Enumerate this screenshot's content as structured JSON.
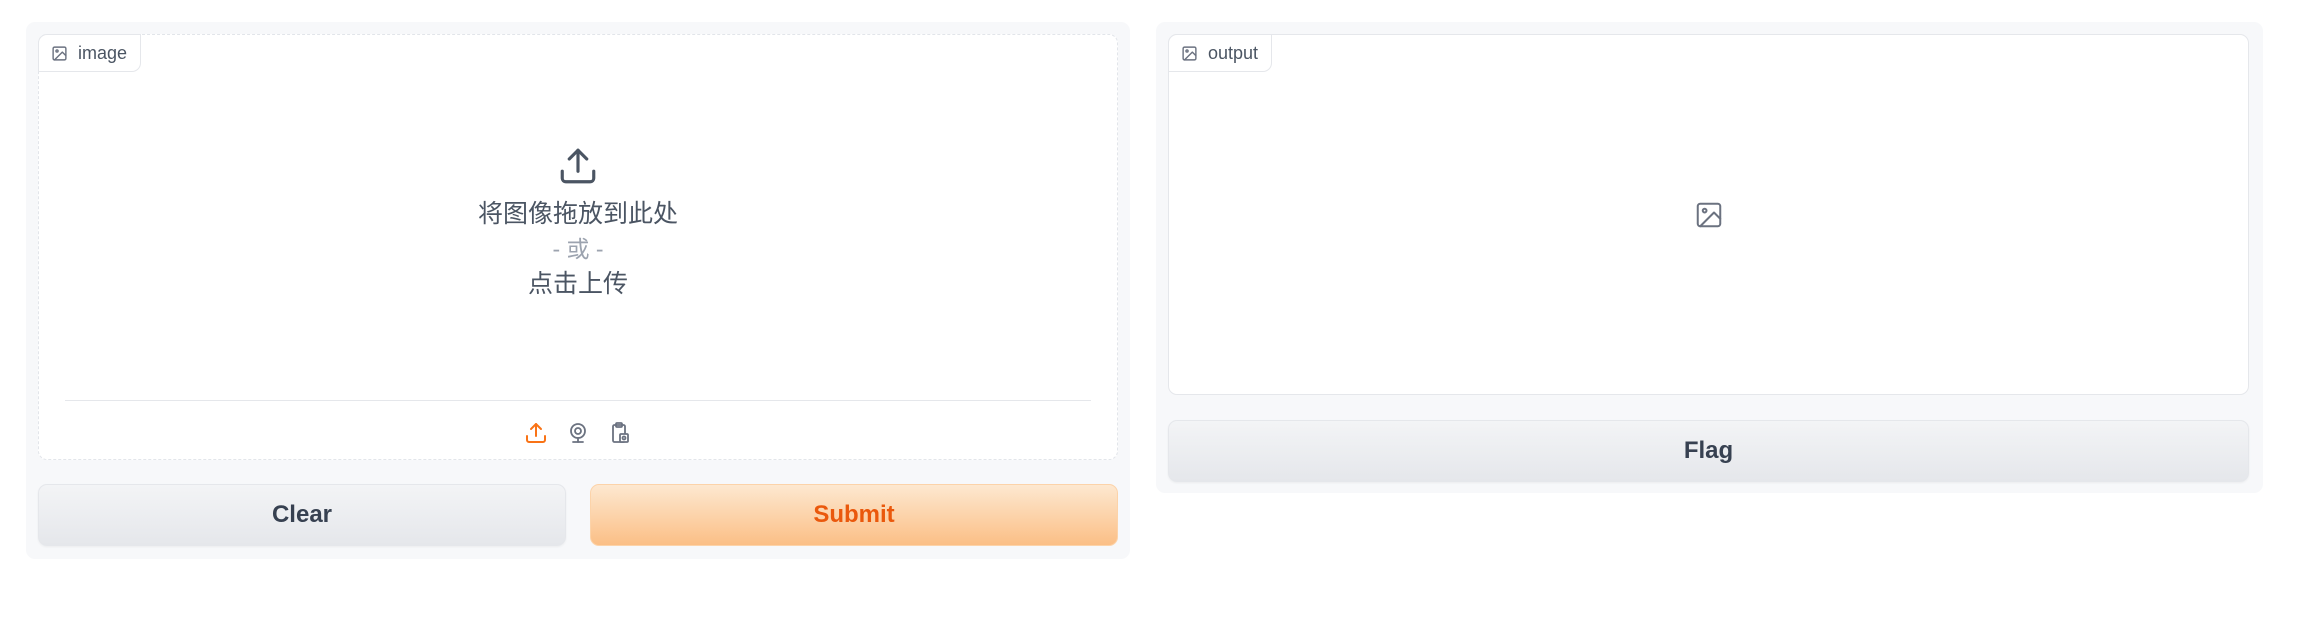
{
  "input": {
    "label": "image",
    "upload": {
      "drop_text": "将图像拖放到此处",
      "or_text": "- 或 -",
      "click_text": "点击上传"
    },
    "sources": [
      "upload-icon",
      "webcam-icon",
      "clipboard-icon"
    ],
    "active_source_color": "#f97316"
  },
  "output": {
    "label": "output"
  },
  "actions": {
    "clear_label": "Clear",
    "submit_label": "Submit",
    "flag_label": "Flag"
  },
  "colors": {
    "primary_text": "#ea580c",
    "primary_gradient_start": "#fde8d0",
    "primary_gradient_end": "#fbbf86"
  }
}
